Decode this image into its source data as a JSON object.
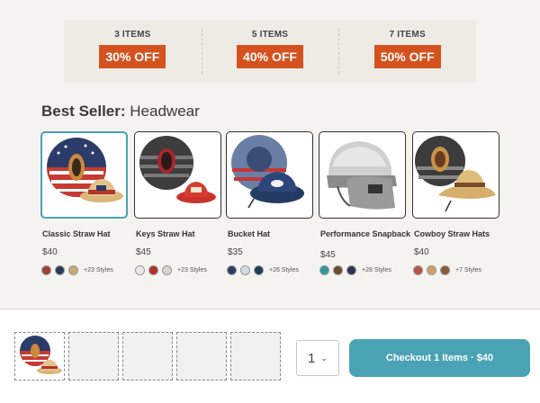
{
  "promo": [
    {
      "count": "3 ITEMS",
      "off": "30% OFF"
    },
    {
      "count": "5 ITEMS",
      "off": "40% OFF"
    },
    {
      "count": "7 ITEMS",
      "off": "50% OFF"
    }
  ],
  "section": {
    "bold": "Best Seller:",
    "rest": "Headwear"
  },
  "products": [
    {
      "name": "Classic Straw Hat",
      "price": "$40",
      "more": "+23 Styles",
      "swatches": [
        "#a0423a",
        "#2a3a5e",
        "#c9a877"
      ]
    },
    {
      "name": "Keys Straw Hat",
      "price": "$45",
      "more": "+23 Styles",
      "swatches": [
        "#e9e9e9",
        "#b0322d",
        "#d9d4cc"
      ]
    },
    {
      "name": "Bucket Hat",
      "price": "$35",
      "more": "+26 Styles",
      "swatches": [
        "#2c3e66",
        "#d5d9e0",
        "#1f3b5c"
      ]
    },
    {
      "name": "Performance Snapback",
      "price": "$45",
      "more": "+28 Styles",
      "swatches": [
        "#2f9a9a",
        "#6b4a2e",
        "#2b3552"
      ]
    },
    {
      "name": "Cowboy Straw Hats",
      "price": "$40",
      "more": "+7 Styles",
      "swatches": [
        "#b4544a",
        "#c9a26b",
        "#8a5a3a"
      ]
    }
  ],
  "cart": {
    "quantity": "1",
    "checkout_label": "Checkout 1 Items · $40"
  },
  "colors": {
    "accent": "#4aa3b5",
    "promo": "#d5521f"
  }
}
